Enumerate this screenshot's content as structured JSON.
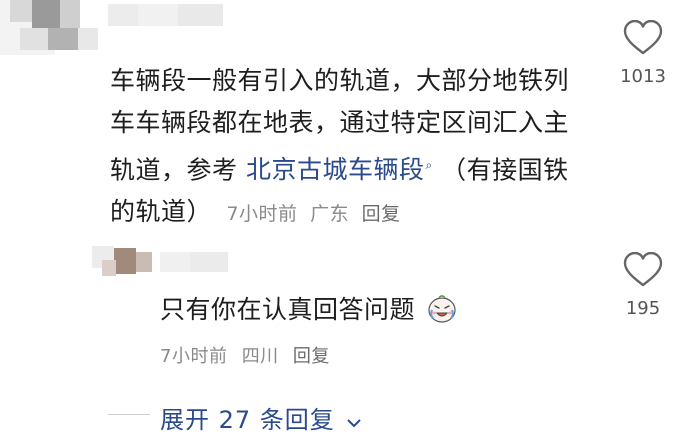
{
  "comment": {
    "text_before_link": "车辆段一般有引入的轨道，大部分地铁列车车辆段都在地表，通过特定区间汇入主轨道，参考 ",
    "link_text": "北京古城车辆段",
    "text_after_link": " （有接国铁的轨道）",
    "time": "7小时前",
    "location": "广东",
    "reply_label": "回复",
    "like_count": "1013",
    "like_icon": "heart-outline-icon"
  },
  "reply": {
    "text": "只有你在认真回答问题",
    "emoji": "crying-laughing-face",
    "time": "7小时前",
    "location": "四川",
    "reply_label": "回复",
    "like_count": "195",
    "like_icon": "heart-outline-icon"
  },
  "expand": {
    "label": "展开 27 条回复",
    "icon": "chevron-down-icon"
  },
  "colors": {
    "link": "#2a4a8c",
    "meta": "#8a8a8a",
    "text": "#1e1e1e"
  }
}
